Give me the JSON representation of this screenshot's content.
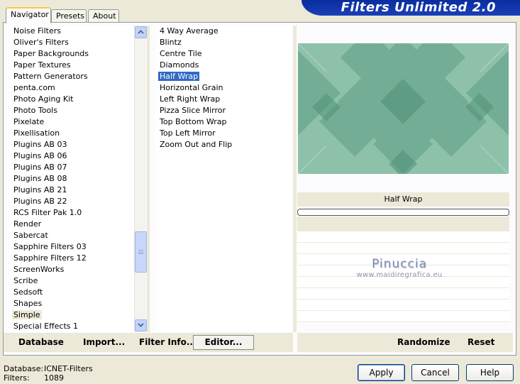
{
  "banner": {
    "title": "Filters Unlimited 2.0"
  },
  "tabs": [
    {
      "label": "Navigator",
      "active": true
    },
    {
      "label": "Presets",
      "active": false
    },
    {
      "label": "About",
      "active": false
    }
  ],
  "categories": {
    "items": [
      "Noise Filters",
      "Oliver's Filters",
      "Paper Backgrounds",
      "Paper Textures",
      "Pattern Generators",
      "penta.com",
      "Photo Aging Kit",
      "Photo Tools",
      "Pixelate",
      "Pixellisation",
      "Plugins AB 03",
      "Plugins AB 06",
      "Plugins AB 07",
      "Plugins AB 08",
      "Plugins AB 21",
      "Plugins AB 22",
      "RCS Filter Pak 1.0",
      "Render",
      "Sabercat",
      "Sapphire Filters 03",
      "Sapphire Filters 12",
      "ScreenWorks",
      "Scribe",
      "Sedsoft",
      "Shapes",
      "Simple",
      "Special Effects 1"
    ],
    "selected": "Simple"
  },
  "filters": {
    "items": [
      "4 Way Average",
      "Blintz",
      "Centre Tile",
      "Diamonds",
      "Half Wrap",
      "Horizontal Grain",
      "Left Right Wrap",
      "Pizza Slice Mirror",
      "Top Bottom Wrap",
      "Top Left Mirror",
      "Zoom Out and Flip"
    ],
    "selected": "Half Wrap"
  },
  "preview": {
    "filter_name": "Half Wrap",
    "progress": 0
  },
  "watermark": {
    "line1": "Pinuccia",
    "line2": "www.maidiregrafica.eu"
  },
  "toolbar": {
    "database": "Database",
    "import": "Import...",
    "filter_info": "Filter Info...",
    "editor": "Editor...",
    "randomize": "Randomize",
    "reset": "Reset"
  },
  "status": {
    "database_label": "Database:",
    "database_value": "ICNET-Filters",
    "filters_label": "Filters:",
    "filters_value": "1089"
  },
  "buttons": {
    "apply": "Apply",
    "cancel": "Cancel",
    "help": "Help"
  },
  "colors": {
    "selection": "#316ac5",
    "banner": "#0a2d9e",
    "preview_bg": "#8ec1aa",
    "preview_diamond": "#5f9e85"
  }
}
